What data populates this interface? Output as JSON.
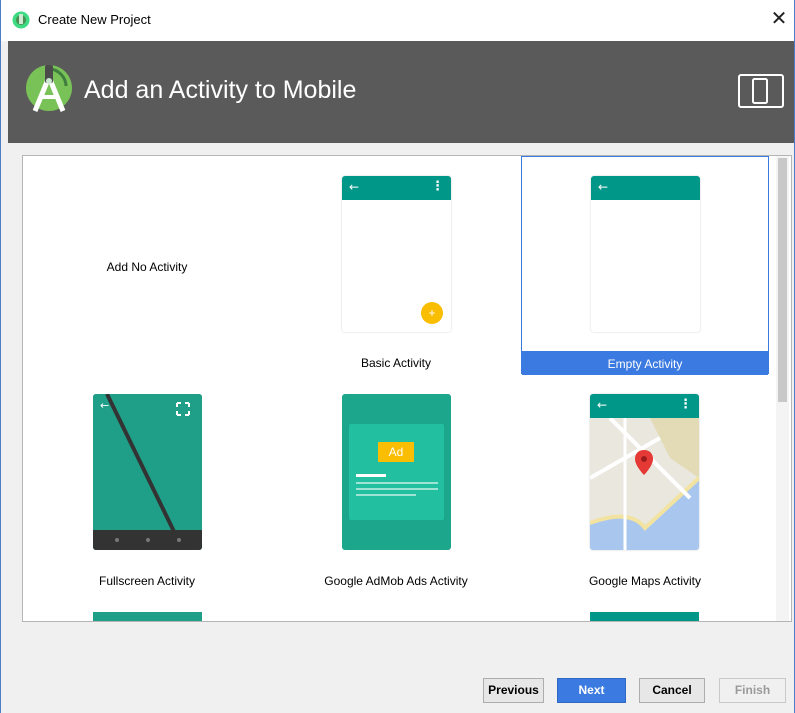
{
  "window": {
    "title": "Create New Project",
    "close_glyph": "✕"
  },
  "header": {
    "title": "Add an Activity to Mobile",
    "logo_icon": "android-studio-logo-icon",
    "device_icon": "phone-tablet-icon",
    "background_color": "#5a5a5a"
  },
  "gallery": {
    "selected": "Empty Activity",
    "items": [
      {
        "label": "Add No Activity"
      },
      {
        "label": "Basic Activity"
      },
      {
        "label": "Empty Activity"
      },
      {
        "label": "Fullscreen Activity"
      },
      {
        "label": "Google AdMob Ads Activity",
        "ad_badge": "Ad"
      },
      {
        "label": "Google Maps Activity"
      }
    ]
  },
  "buttons": {
    "previous": "Previous",
    "next": "Next",
    "cancel": "Cancel",
    "finish": "Finish"
  },
  "colors": {
    "accent": "#3b7ae0",
    "teal": "#009688",
    "fab": "#f9bd02"
  }
}
